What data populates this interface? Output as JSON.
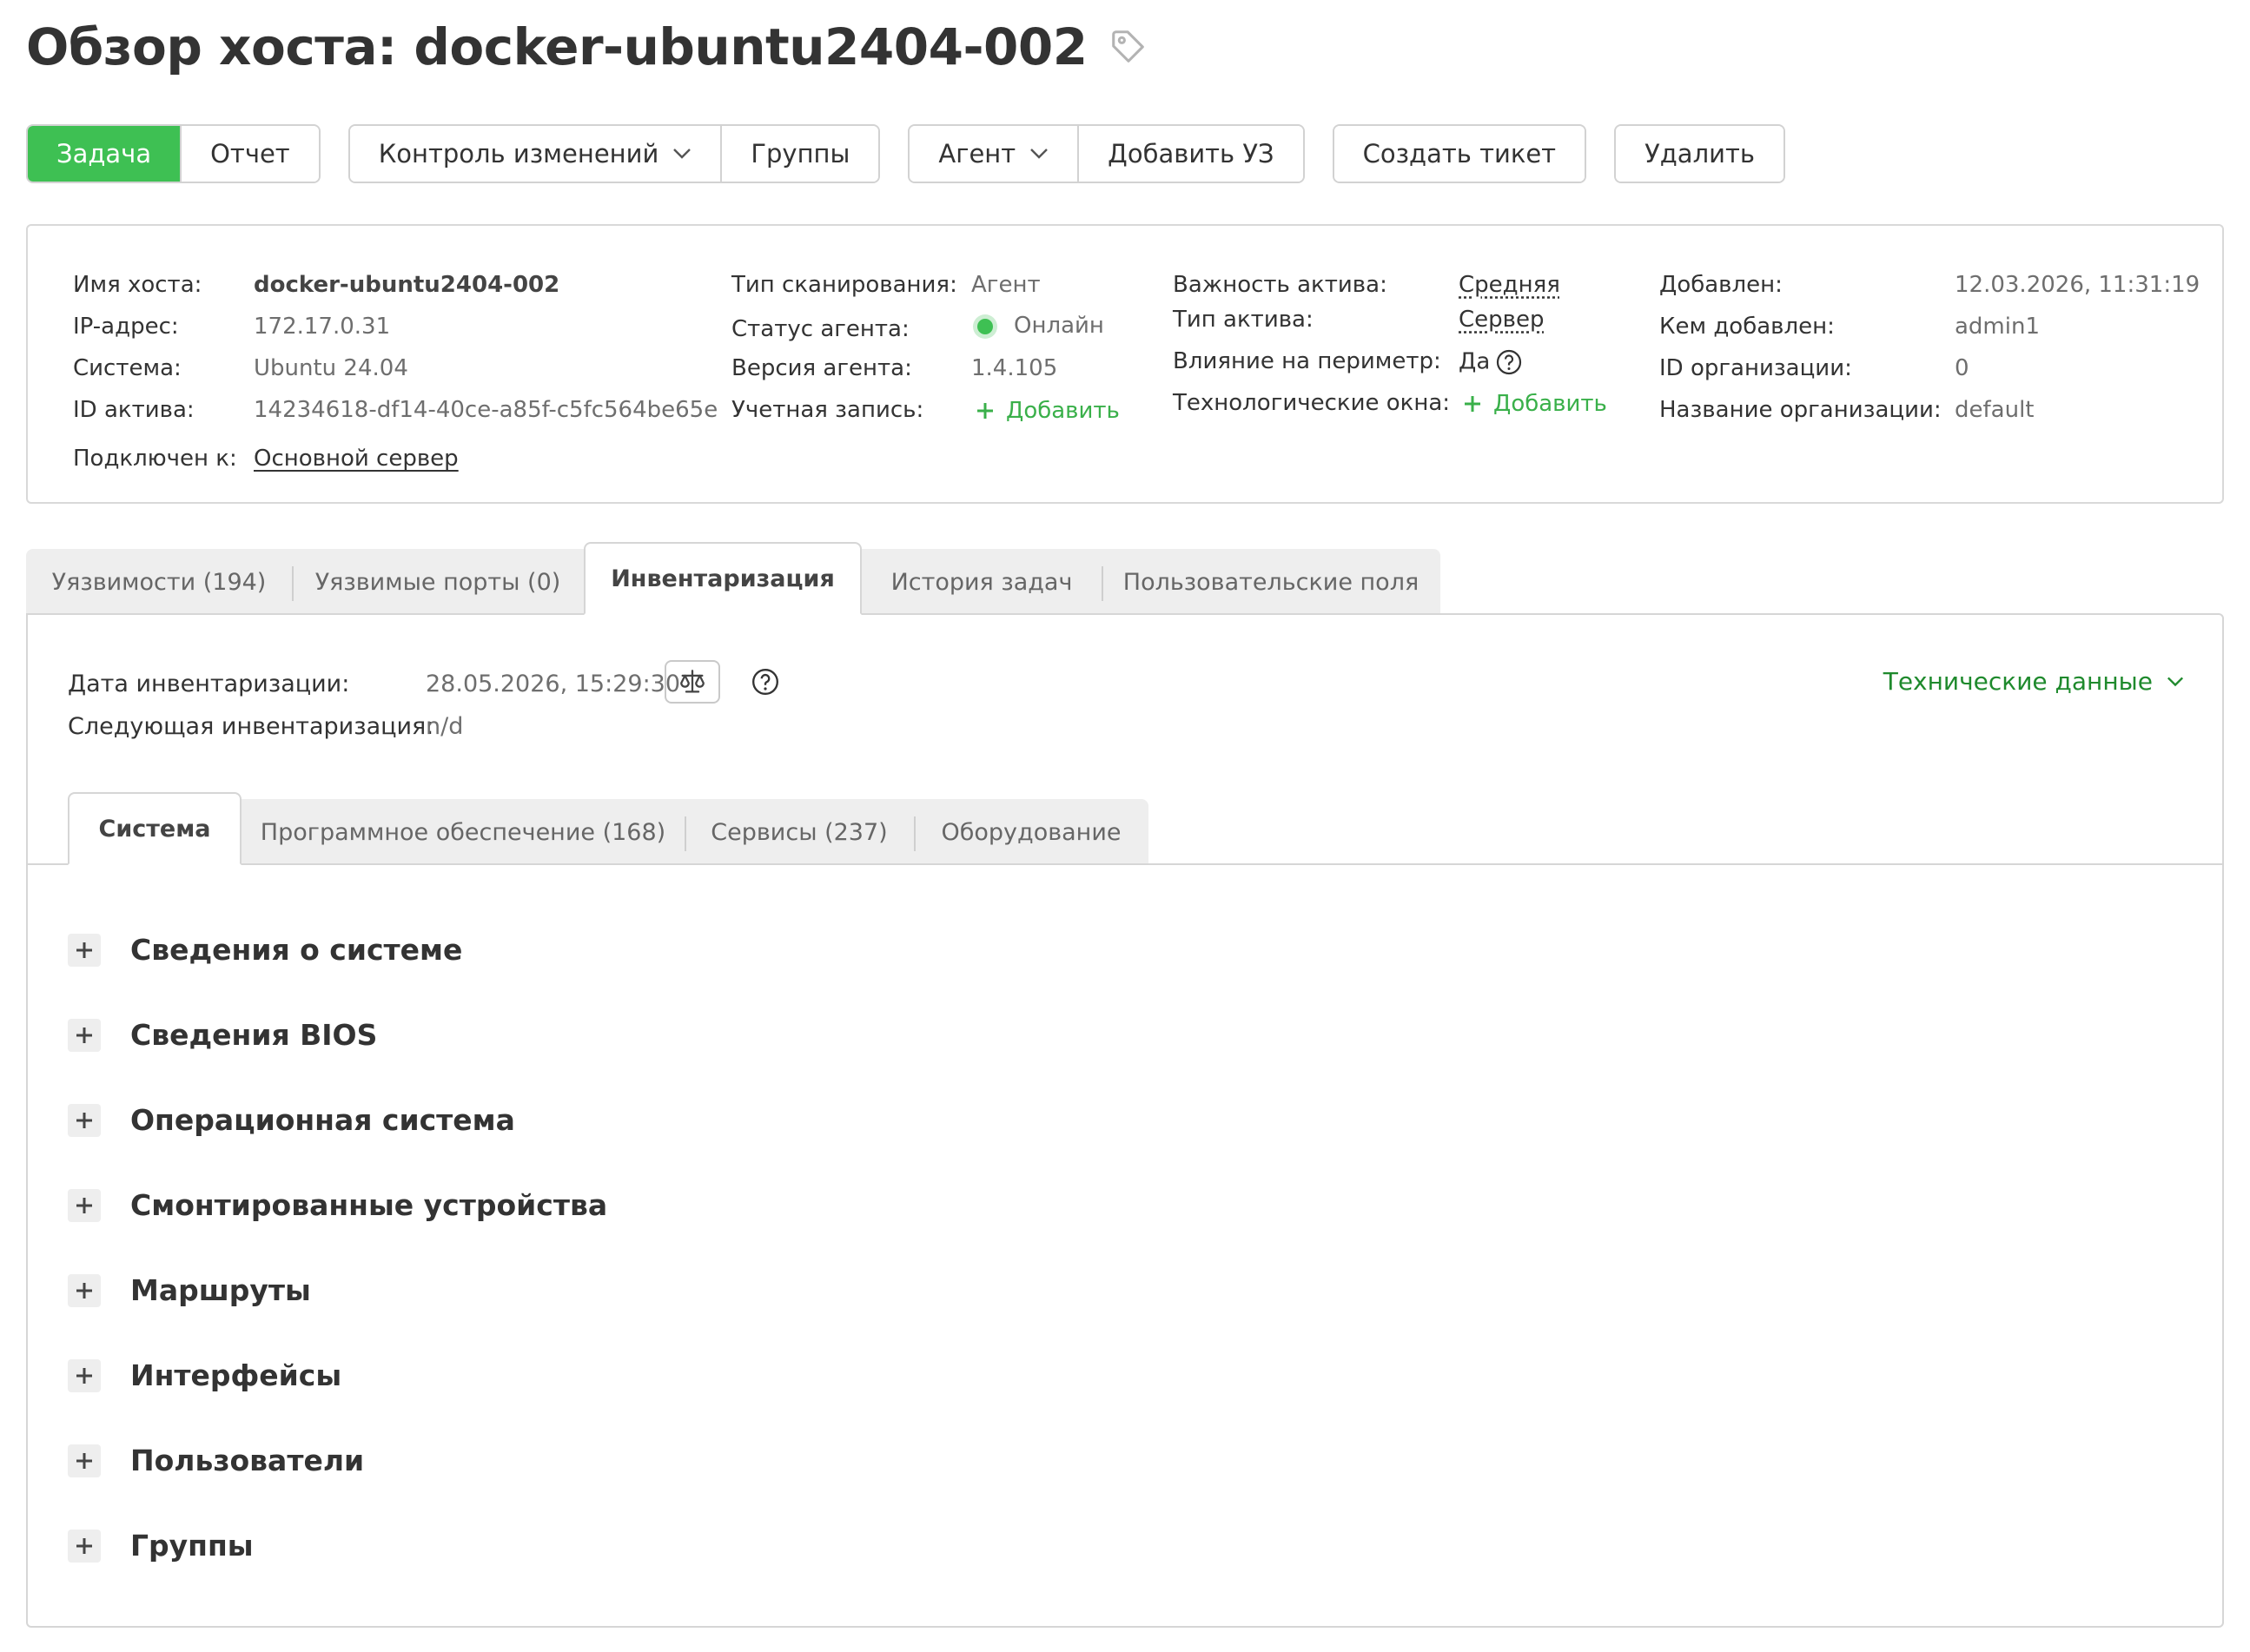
{
  "header": {
    "title": "Обзор хоста: docker-ubuntu2404-002"
  },
  "toolbar": {
    "task": "Задача",
    "report": "Отчет",
    "change_control": "Контроль изменений",
    "groups": "Группы",
    "agent": "Агент",
    "add_account": "Добавить УЗ",
    "create_ticket": "Создать тикет",
    "delete": "Удалить"
  },
  "info": {
    "host_name_label": "Имя хоста:",
    "host_name": "docker-ubuntu2404-002",
    "ip_label": "IP-адрес:",
    "ip": "172.17.0.31",
    "system_label": "Система:",
    "system": "Ubuntu 24.04",
    "asset_id_label": "ID актива:",
    "asset_id": "14234618-df14-40ce-a85f-c5fc564be65e",
    "connected_label": "Подключен к:",
    "connected": "Основной сервер",
    "scan_type_label": "Тип сканирования:",
    "scan_type": "Агент",
    "agent_status_label": "Статус агента:",
    "agent_status": "Онлайн",
    "agent_version_label": "Версия агента:",
    "agent_version": "1.4.105",
    "account_label": "Учетная запись:",
    "account_add": "Добавить",
    "importance_label": "Важность актива:",
    "importance": "Средняя",
    "asset_type_label": "Тип актива:",
    "asset_type": "Сервер",
    "perimeter_label": "Влияние на периметр:",
    "perimeter": "Да",
    "tech_windows_label": "Технологические окна:",
    "tech_windows_add": "Добавить",
    "added_label": "Добавлен:",
    "added": "12.03.2026, 11:31:19",
    "added_by_label": "Кем добавлен:",
    "added_by": "admin1",
    "org_id_label": "ID организации:",
    "org_id": "0",
    "org_name_label": "Название организации:",
    "org_name": "default"
  },
  "tabs": [
    "Уязвимости (194)",
    "Уязвимые порты (0)",
    "Инвентаризация",
    "История задач",
    "Пользовательские поля"
  ],
  "inventory": {
    "date_label": "Дата инвентаризации:",
    "date": "28.05.2026, 15:29:30",
    "next_label": "Следующая инвентаризация:",
    "next": "n/d",
    "tech_data": "Технические данные"
  },
  "subtabs": [
    "Система",
    "Программное обеспечение (168)",
    "Сервисы (237)",
    "Оборудование"
  ],
  "sections": [
    "Сведения о системе",
    "Сведения BIOS",
    "Операционная система",
    "Смонтированные устройства",
    "Маршруты",
    "Интерфейсы",
    "Пользователи",
    "Группы"
  ],
  "colors": {
    "accent": "#3ec053",
    "link_green": "#1f8a2d"
  }
}
